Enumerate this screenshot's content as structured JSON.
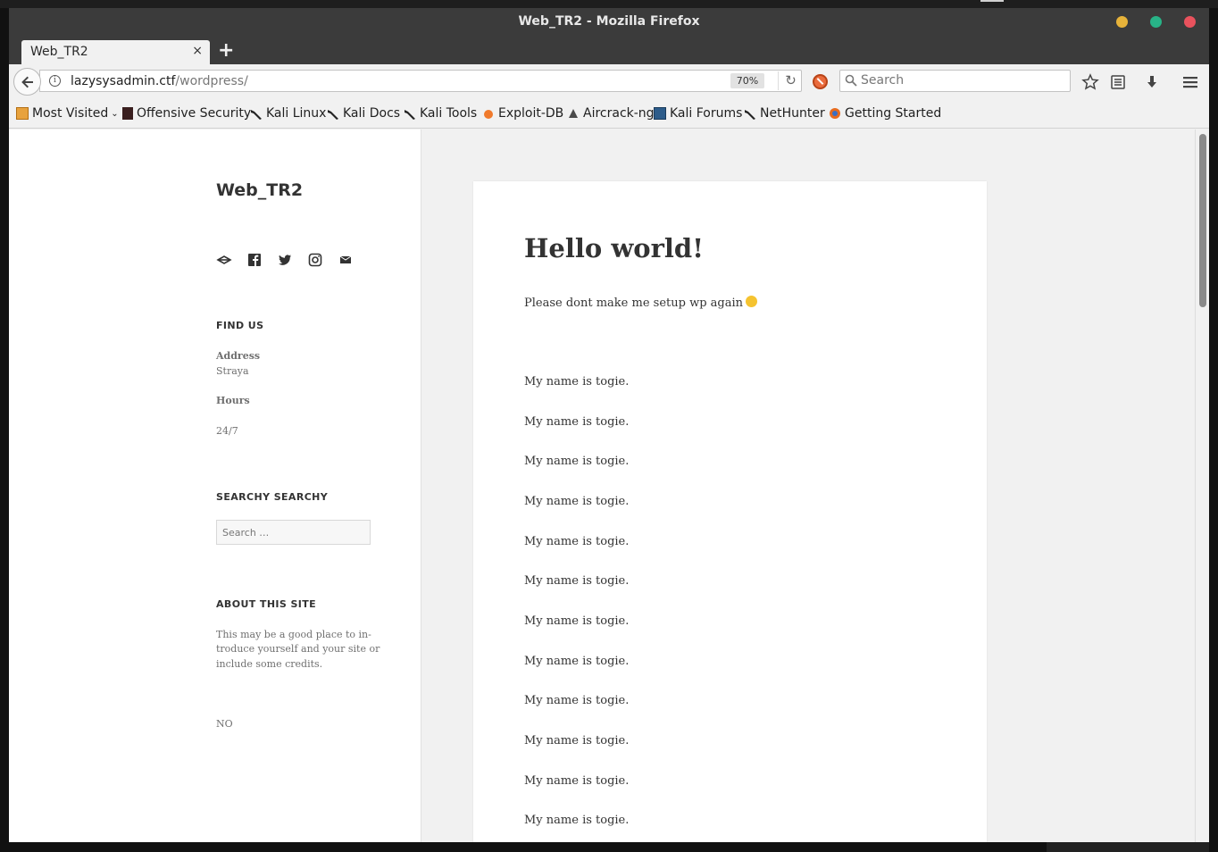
{
  "window": {
    "title": "Web_TR2 - Mozilla Firefox"
  },
  "tab": {
    "title": "Web_TR2",
    "close": "×"
  },
  "new_tab_label": "+",
  "address_bar": {
    "host": "lazysysadmin.ctf",
    "path": "/wordpress/",
    "zoom": "70%"
  },
  "search_bar": {
    "placeholder": "Search"
  },
  "bookmarks": [
    {
      "label": "Most Visited",
      "icon": "folder-icon",
      "dropdown": true
    },
    {
      "label": "Offensive Security",
      "icon": "offsec-icon"
    },
    {
      "label": "Kali Linux",
      "icon": "kali-dragon-icon"
    },
    {
      "label": "Kali Docs",
      "icon": "kali-dragon-icon"
    },
    {
      "label": "Kali Tools",
      "icon": "kali-dragon-icon"
    },
    {
      "label": "Exploit-DB",
      "icon": "exploit-db-icon"
    },
    {
      "label": "Aircrack-ng",
      "icon": "aircrack-icon"
    },
    {
      "label": "Kali Forums",
      "icon": "kali-forums-icon"
    },
    {
      "label": "NetHunter",
      "icon": "kali-dragon-icon"
    },
    {
      "label": "Getting Started",
      "icon": "firefox-icon"
    }
  ],
  "sidebar": {
    "site_title": "Web_TR2",
    "social_icons": [
      "codepen-icon",
      "facebook-icon",
      "twitter-icon",
      "instagram-icon",
      "mail-icon"
    ],
    "find_us": {
      "heading": "FIND US",
      "address_label": "Address",
      "address_value": "Straya",
      "hours_label": "Hours",
      "hours_value": "24/7"
    },
    "search_widget": {
      "heading": "SEARCHY SEARCHY",
      "placeholder": "Search …"
    },
    "about": {
      "heading": "ABOUT THIS SITE",
      "line1": "This may be a good place to in-",
      "line2": "troduce yourself and your site or",
      "line3": "include some credits."
    },
    "footer_text": "NO"
  },
  "post": {
    "title": "Hello world!",
    "intro": "Please dont make me setup wp again",
    "lines": [
      "My name is togie.",
      "My name is togie.",
      "My name is togie.",
      "My name is togie.",
      "My name is togie.",
      "My name is togie.",
      "My name is togie.",
      "My name is togie.",
      "My name is togie.",
      "My name is togie.",
      "My name is togie.",
      "My name is togie."
    ]
  },
  "colors": {
    "titlebar": "#3b3b3b",
    "minimize": "#e7b33a",
    "maximize": "#28b387",
    "close": "#e9525d"
  }
}
